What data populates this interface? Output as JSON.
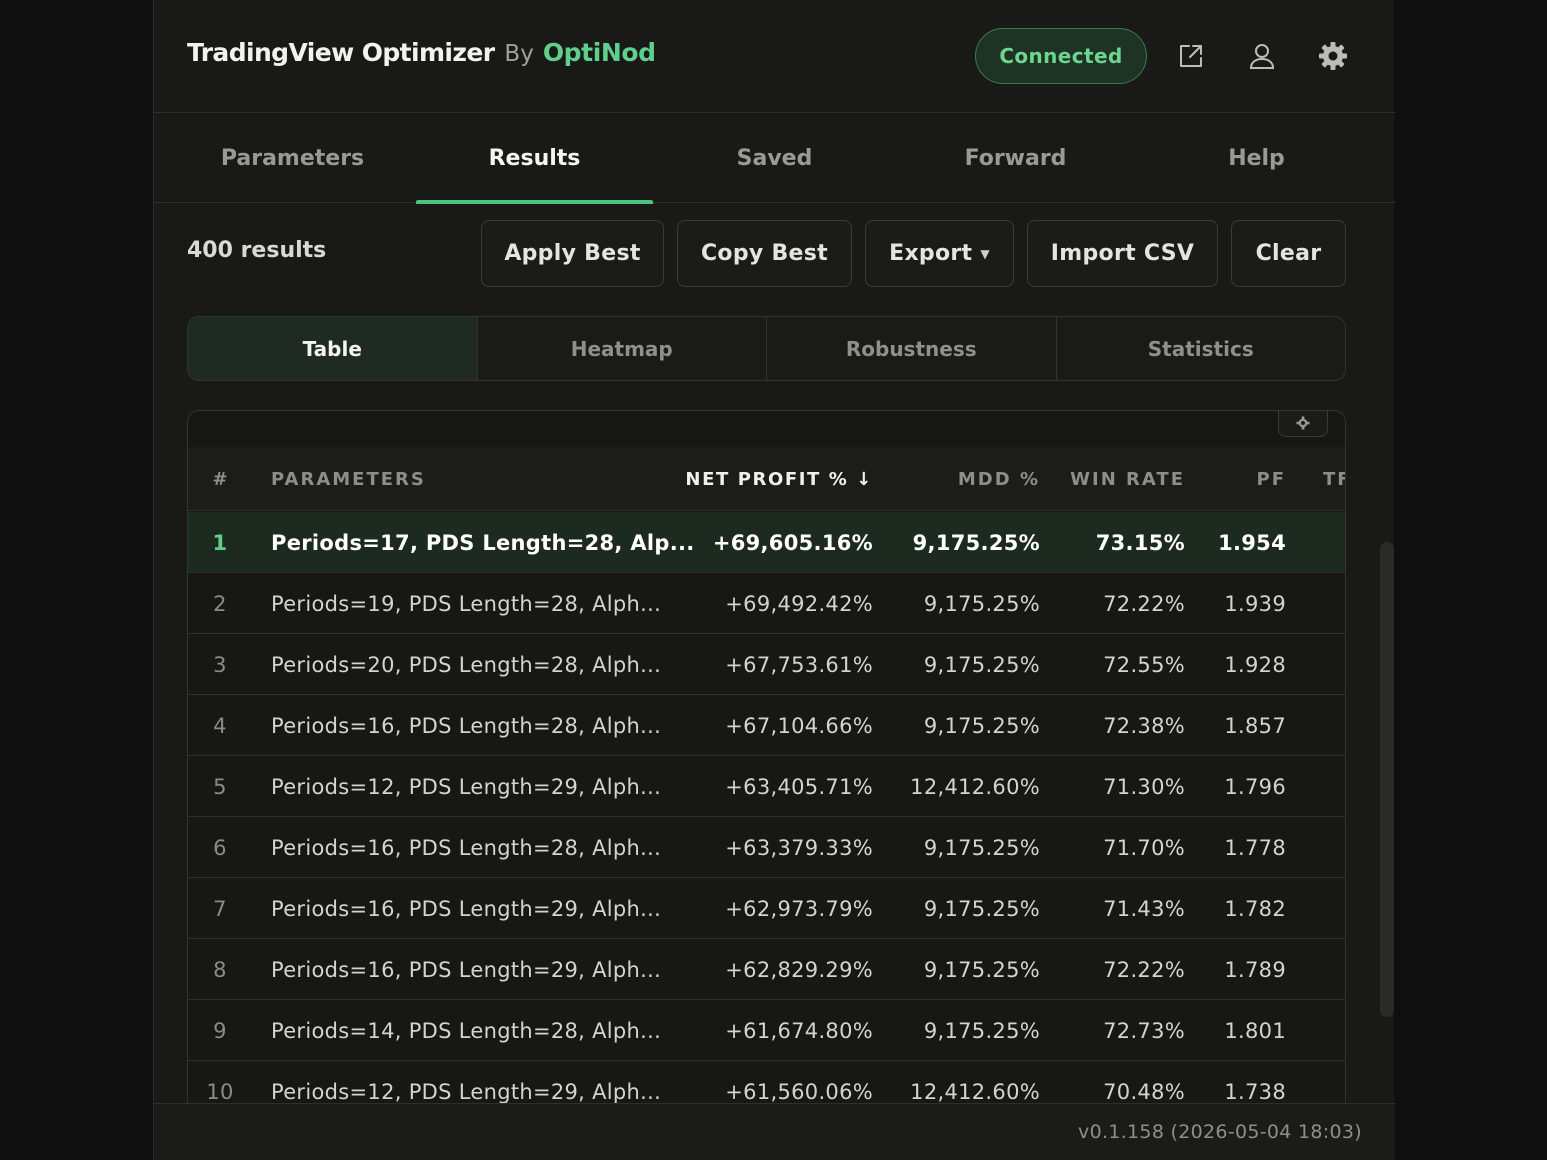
{
  "header": {
    "app_name": "TradingView Optimizer",
    "by": "By",
    "company": "OptiNod",
    "status": "Connected",
    "icons": [
      "external-link-icon",
      "user-icon",
      "gear-icon"
    ]
  },
  "nav": {
    "tabs": [
      {
        "label": "Parameters",
        "active": false
      },
      {
        "label": "Results",
        "active": true
      },
      {
        "label": "Saved",
        "active": false
      },
      {
        "label": "Forward",
        "active": false
      },
      {
        "label": "Help",
        "active": false
      }
    ]
  },
  "toolbar": {
    "count": "400 results",
    "apply_best": "Apply Best",
    "copy_best": "Copy Best",
    "export": "Export",
    "import_csv": "Import CSV",
    "clear": "Clear"
  },
  "views": {
    "items": [
      {
        "label": "Table",
        "active": true
      },
      {
        "label": "Heatmap",
        "active": false
      },
      {
        "label": "Robustness",
        "active": false
      },
      {
        "label": "Statistics",
        "active": false
      }
    ]
  },
  "table": {
    "columns": [
      "#",
      "PARAMETERS",
      "NET PROFIT % ↓",
      "MDD %",
      "WIN RATE",
      "PF",
      "TF"
    ],
    "sorted_column": "NET PROFIT % ↓",
    "rows": [
      {
        "n": "1",
        "params": "Periods=17, PDS Length=28, Alp...",
        "net": "+69,605.16%",
        "mdd": "9,175.25%",
        "win": "73.15%",
        "pf": "1.954",
        "best": true
      },
      {
        "n": "2",
        "params": "Periods=19, PDS Length=28, Alph...",
        "net": "+69,492.42%",
        "mdd": "9,175.25%",
        "win": "72.22%",
        "pf": "1.939",
        "best": false
      },
      {
        "n": "3",
        "params": "Periods=20, PDS Length=28, Alph...",
        "net": "+67,753.61%",
        "mdd": "9,175.25%",
        "win": "72.55%",
        "pf": "1.928",
        "best": false
      },
      {
        "n": "4",
        "params": "Periods=16, PDS Length=28, Alph...",
        "net": "+67,104.66%",
        "mdd": "9,175.25%",
        "win": "72.38%",
        "pf": "1.857",
        "best": false
      },
      {
        "n": "5",
        "params": "Periods=12, PDS Length=29, Alph...",
        "net": "+63,405.71%",
        "mdd": "12,412.60%",
        "win": "71.30%",
        "pf": "1.796",
        "best": false
      },
      {
        "n": "6",
        "params": "Periods=16, PDS Length=28, Alph...",
        "net": "+63,379.33%",
        "mdd": "9,175.25%",
        "win": "71.70%",
        "pf": "1.778",
        "best": false
      },
      {
        "n": "7",
        "params": "Periods=16, PDS Length=29, Alph...",
        "net": "+62,973.79%",
        "mdd": "9,175.25%",
        "win": "71.43%",
        "pf": "1.782",
        "best": false
      },
      {
        "n": "8",
        "params": "Periods=16, PDS Length=29, Alph...",
        "net": "+62,829.29%",
        "mdd": "9,175.25%",
        "win": "72.22%",
        "pf": "1.789",
        "best": false
      },
      {
        "n": "9",
        "params": "Periods=14, PDS Length=28, Alph...",
        "net": "+61,674.80%",
        "mdd": "9,175.25%",
        "win": "72.73%",
        "pf": "1.801",
        "best": false
      },
      {
        "n": "10",
        "params": "Periods=12, PDS Length=29, Alph...",
        "net": "+61,560.06%",
        "mdd": "12,412.60%",
        "win": "70.48%",
        "pf": "1.738",
        "best": false
      }
    ]
  },
  "footer": {
    "version": "v0.1.158 (2026-05-04 18:03)"
  },
  "colors": {
    "accent": "#5fcf8c",
    "background": "#191917",
    "best_row": "#1c2a20"
  }
}
